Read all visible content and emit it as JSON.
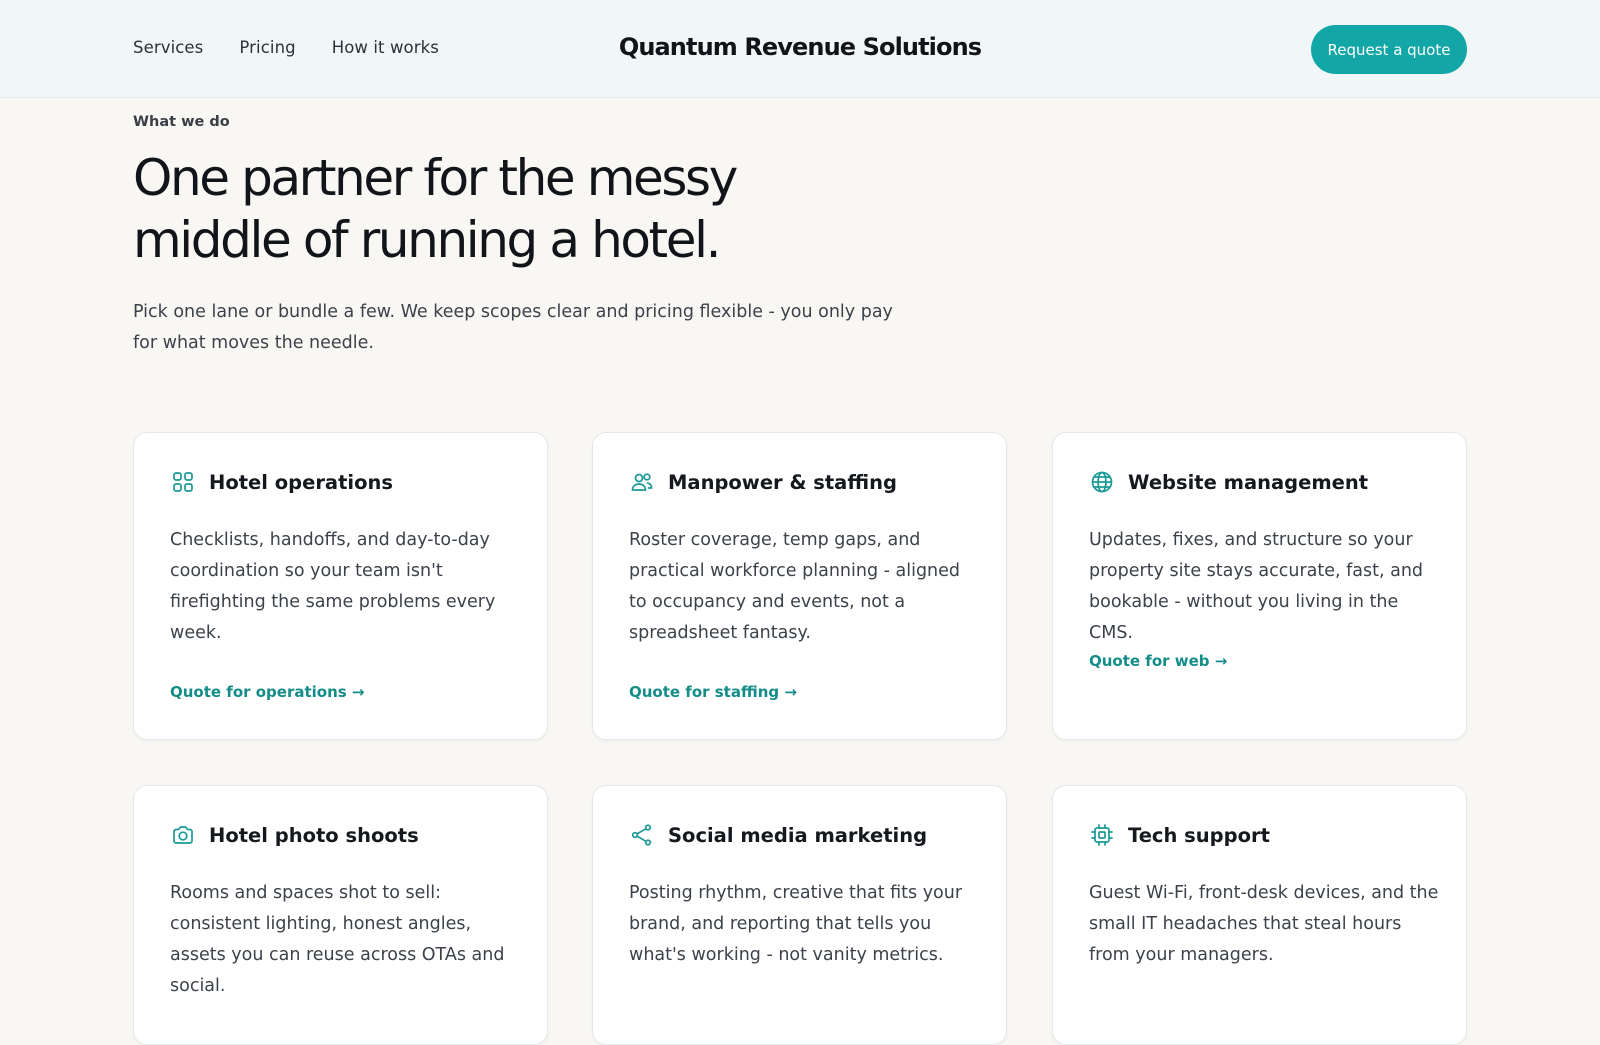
{
  "header": {
    "nav": [
      "Services",
      "Pricing",
      "How it works"
    ],
    "brand": "Quantum Revenue Solutions",
    "cta": "Request a quote"
  },
  "hero": {
    "eyebrow": "What we do",
    "headline_line1": "One partner for the messy",
    "headline_line2": "middle of running a hotel.",
    "lede": "Pick one lane or bundle a few. We keep scopes clear and pricing flexible - you only pay for what moves the needle."
  },
  "colors": {
    "accent": "#13a6a6",
    "link": "#148d88",
    "background": "#f8f7f4",
    "header_bg": "#f1f6f9"
  },
  "services": [
    {
      "icon": "grid-icon",
      "title": "Hotel operations",
      "text": "Checklists, handoffs, and day-to-day coordination so your team isn't firefighting the same problems every week.",
      "link": "Quote for operations →"
    },
    {
      "icon": "users-icon",
      "title": "Manpower & staffing",
      "text": "Roster coverage, temp gaps, and practical workforce planning - aligned to occupancy and events, not a spreadsheet fantasy.",
      "link": "Quote for staffing →"
    },
    {
      "icon": "globe-icon",
      "title": "Website management",
      "text": "Updates, fixes, and structure so your property site stays accurate, fast, and bookable - without you living in the CMS.",
      "link": "Quote for web →"
    },
    {
      "icon": "camera-icon",
      "title": "Hotel photo shoots",
      "text": "Rooms and spaces shot to sell: consistent lighting, honest angles, assets you can reuse across OTAs and social."
    },
    {
      "icon": "share-icon",
      "title": "Social media marketing",
      "text": "Posting rhythm, creative that fits your brand, and reporting that tells you what's working - not vanity metrics."
    },
    {
      "icon": "cpu-icon",
      "title": "Tech support",
      "text": "Guest Wi-Fi, front-desk devices, and the small IT headaches that steal hours from your managers."
    }
  ]
}
